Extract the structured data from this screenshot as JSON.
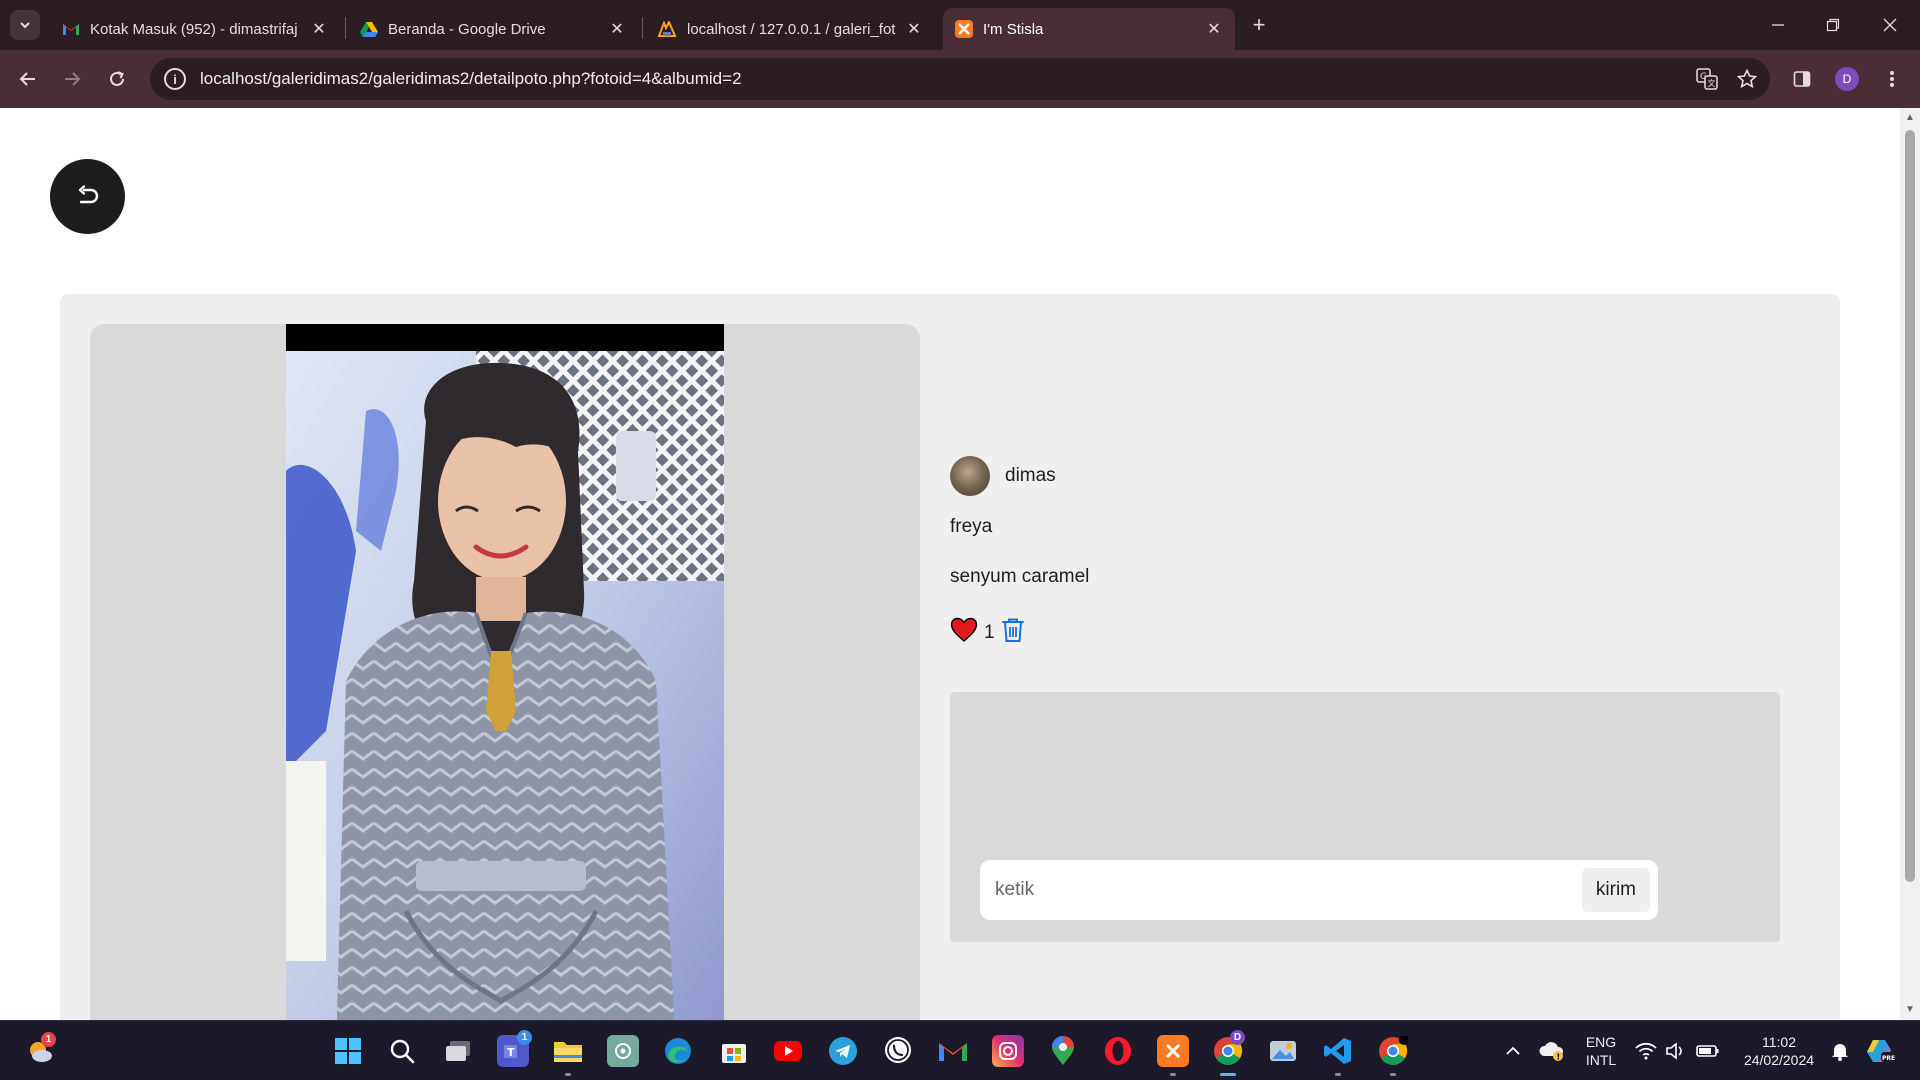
{
  "browser": {
    "tabs": [
      {
        "title": "Kotak Masuk (952) - dimastrifaj",
        "icon": "gmail-icon"
      },
      {
        "title": "Beranda - Google Drive",
        "icon": "google-drive-icon"
      },
      {
        "title": "localhost / 127.0.0.1 / galeri_fot",
        "icon": "phpmyadmin-icon"
      },
      {
        "title": "I'm Stisla",
        "icon": "xampp-icon",
        "active": true
      }
    ],
    "url": "localhost/galeridimas2/galeridimas2/detailpoto.php?fotoid=4&albumid=2",
    "profile_initial": "D",
    "accent_color": "#4a2e37"
  },
  "page": {
    "owner": {
      "name": "dimas"
    },
    "photo": {
      "title": "freya",
      "description": "senyum caramel"
    },
    "likes": {
      "count": "1",
      "liked": true,
      "heart_color": "#e01b1b"
    },
    "comment": {
      "placeholder": "ketik",
      "value": "",
      "send_label": "kirim"
    }
  },
  "taskbar": {
    "widgets_badge": "1",
    "teams_badge": "1",
    "chrome_badge": "D",
    "lang_top": "ENG",
    "lang_bottom": "INTL",
    "time": "11:02",
    "date": "24/02/2024",
    "apps": [
      "windows-start",
      "search",
      "task-view",
      "teams",
      "file-explorer",
      "chatgpt",
      "edge",
      "microsoft-store",
      "youtube",
      "telegram",
      "whatsapp",
      "gmail",
      "instagram",
      "google-maps",
      "opera",
      "xampp",
      "chrome",
      "photos",
      "vscode",
      "chrome-alt"
    ]
  }
}
